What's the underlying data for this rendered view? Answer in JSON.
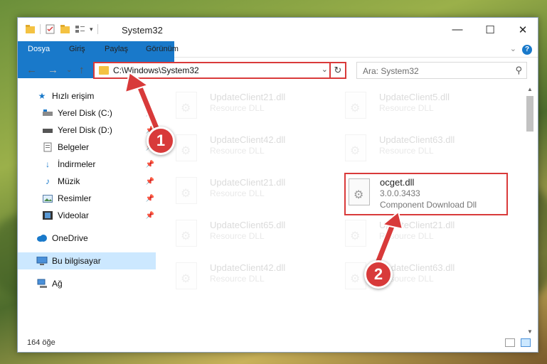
{
  "window": {
    "title": "System32",
    "controls": {
      "minimize": "—",
      "maximize": "☐",
      "close": "✕"
    }
  },
  "ribbon": {
    "tabs": [
      "Dosya",
      "Giriş",
      "Paylaş",
      "Görünüm"
    ],
    "help": "?"
  },
  "address": {
    "path": "C:\\Windows\\System32",
    "search_placeholder": "Ara: System32"
  },
  "sidebar": {
    "items": [
      {
        "label": "Hızlı erişim",
        "icon": "star-icon"
      },
      {
        "label": "Yerel Disk (C:)",
        "icon": "drive-icon"
      },
      {
        "label": "Yerel Disk (D:)",
        "icon": "drive-icon"
      },
      {
        "label": "Belgeler",
        "icon": "documents-icon"
      },
      {
        "label": "İndirmeler",
        "icon": "download-icon"
      },
      {
        "label": "Müzik",
        "icon": "music-icon"
      },
      {
        "label": "Resimler",
        "icon": "pictures-icon"
      },
      {
        "label": "Videolar",
        "icon": "videos-icon"
      },
      {
        "label": "OneDrive",
        "icon": "cloud-icon"
      },
      {
        "label": "Bu bilgisayar",
        "icon": "computer-icon"
      },
      {
        "label": "Ağ",
        "icon": "network-icon"
      }
    ]
  },
  "files": [
    {
      "name": "UpdateClient21.dll",
      "desc": "Resource DLL"
    },
    {
      "name": "UpdateClient5.dll",
      "desc": "Resource DLL"
    },
    {
      "name": "UpdateClient42.dll",
      "desc": "Resource DLL"
    },
    {
      "name": "UpdateClient63.dll",
      "desc": "Resource DLL"
    },
    {
      "name": "UpdateClient21.dll",
      "desc": "Resource DLL"
    },
    {
      "name": "ocget.dll",
      "version": "3.0.0.3433",
      "desc": "Component Download Dll"
    },
    {
      "name": "UpdateClient65.dll",
      "desc": "Resource DLL"
    },
    {
      "name": "UpdateClient21.dll",
      "desc": "Resource DLL"
    },
    {
      "name": "UpdateClient42.dll",
      "desc": "Resource DLL"
    },
    {
      "name": "UpdateClient63.dll",
      "desc": "Resource DLL"
    }
  ],
  "status": {
    "count": "164 öğe"
  },
  "callouts": {
    "one": "1",
    "two": "2"
  },
  "colors": {
    "accent": "#1979ca",
    "highlight": "#d93a3a"
  }
}
